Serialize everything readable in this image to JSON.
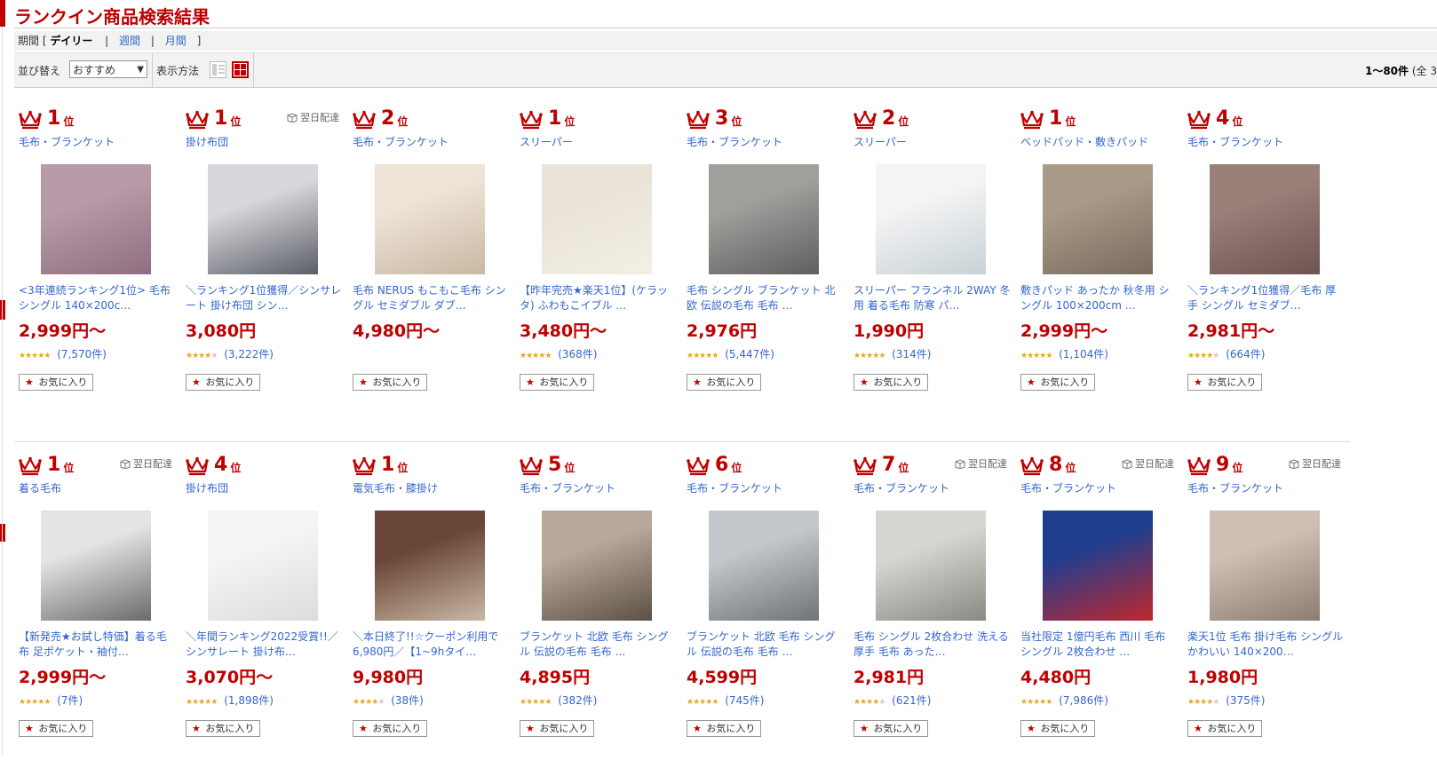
{
  "page": {
    "title": "ランクイン商品検索結果",
    "period": {
      "label": "期間 [",
      "active": "デイリー",
      "weekly": "週間",
      "monthly": "月間",
      "close": "]"
    },
    "sort": {
      "label": "並び替え",
      "selected": "おすすめ"
    },
    "display_label": "表示方法",
    "result_count": "1〜80件",
    "result_total_partial": "(全 3"
  },
  "labels": {
    "delivery": "翌日配達",
    "favorite": "お気に入り",
    "rank_suffix": "位"
  },
  "colors": {
    "accent": "#bf0000",
    "link": "#3366cc",
    "star": "#e4a92a"
  },
  "products": [
    {
      "rank": "1",
      "category": "毛布・ブランケット",
      "name": "<3年連続ランキング1位> 毛布 シングル 140×200c…",
      "price": "2,999円〜",
      "stars": 4.5,
      "reviews": "(7,570件)",
      "delivery": false,
      "img": [
        "#b89aa8",
        "#8f6f80"
      ]
    },
    {
      "rank": "1",
      "category": "掛け布団",
      "name": "＼ランキング1位獲得／シンサレート 掛け布団 シン…",
      "price": "3,080円",
      "stars": 4,
      "reviews": "(3,222件)",
      "delivery": true,
      "img": [
        "#d8d8dc",
        "#5a5f66"
      ]
    },
    {
      "rank": "2",
      "category": "毛布・ブランケット",
      "name": "毛布 NERUS もこもこ毛布 シングル セミダブル ダブ…",
      "price": "4,980円〜",
      "stars": null,
      "reviews": "",
      "delivery": false,
      "img": [
        "#ede3d6",
        "#c9b8a3"
      ]
    },
    {
      "rank": "1",
      "category": "スリーパー",
      "name": "【昨年完売★楽天1位】(ケラッタ) ふわもこイブル …",
      "price": "3,480円〜",
      "stars": 4.5,
      "reviews": "(368件)",
      "delivery": false,
      "img": [
        "#eae4d8",
        "#f3efe5"
      ]
    },
    {
      "rank": "3",
      "category": "毛布・ブランケット",
      "name": "毛布 シングル ブランケット 北欧 伝説の毛布 毛布 …",
      "price": "2,976円",
      "stars": 4.5,
      "reviews": "(5,447件)",
      "delivery": false,
      "img": [
        "#9ea09c",
        "#5e605d"
      ]
    },
    {
      "rank": "2",
      "category": "スリーパー",
      "name": "スリーパー フランネル 2WAY 冬用 着る毛布 防寒 パ…",
      "price": "1,990円",
      "stars": 4.5,
      "reviews": "(314件)",
      "delivery": false,
      "img": [
        "#f4f4f4",
        "#c8d2d6"
      ]
    },
    {
      "rank": "1",
      "category": "ベッドパッド・敷きパッド",
      "name": "敷きパッド あったか 秋冬用 シングル 100×200cm …",
      "price": "2,999円〜",
      "stars": 4.5,
      "reviews": "(1,104件)",
      "delivery": false,
      "img": [
        "#a89a88",
        "#7a6c5c"
      ]
    },
    {
      "rank": "4",
      "category": "毛布・ブランケット",
      "name": "＼ランキング1位獲得／毛布 厚手 シングル セミダブ…",
      "price": "2,981円〜",
      "stars": 4,
      "reviews": "(664件)",
      "delivery": false,
      "img": [
        "#9b7f79",
        "#6d5551"
      ]
    },
    {
      "rank": "1",
      "category": "着る毛布",
      "name": "【新発売★お試し特価】着る毛布 足ポケット・袖付…",
      "price": "2,999円〜",
      "stars": 5,
      "reviews": "(7件)",
      "delivery": true,
      "img": [
        "#e4e4e4",
        "#6a6a6a"
      ]
    },
    {
      "rank": "4",
      "category": "掛け布団",
      "name": "＼年間ランキング2022受賞!!／シンサレート 掛け布…",
      "price": "3,070円〜",
      "stars": 4.5,
      "reviews": "(1,898件)",
      "delivery": false,
      "img": [
        "#f5f5f5",
        "#dcdcdc"
      ]
    },
    {
      "rank": "1",
      "category": "電気毛布・膝掛け",
      "name": "＼本日終了!!☆クーポン利用で6,980円／【1~9hタイ…",
      "price": "9,980円",
      "stars": 4,
      "reviews": "(38件)",
      "delivery": false,
      "img": [
        "#6a4636",
        "#c9b8a6"
      ]
    },
    {
      "rank": "5",
      "category": "毛布・ブランケット",
      "name": "ブランケット 北欧 毛布 シングル 伝説の毛布 毛布 …",
      "price": "4,895円",
      "stars": 4.5,
      "reviews": "(382件)",
      "delivery": false,
      "img": [
        "#b7a89a",
        "#5c5045"
      ]
    },
    {
      "rank": "6",
      "category": "毛布・ブランケット",
      "name": "ブランケット 北欧 毛布 シングル 伝説の毛布 毛布 …",
      "price": "4,599円",
      "stars": 4.5,
      "reviews": "(745件)",
      "delivery": false,
      "img": [
        "#c4c7cb",
        "#6f7479"
      ]
    },
    {
      "rank": "7",
      "category": "毛布・ブランケット",
      "name": "毛布 シングル 2枚合わせ 洗える 厚手 毛布 あった…",
      "price": "2,981円",
      "stars": 4,
      "reviews": "(621件)",
      "delivery": true,
      "img": [
        "#d8d6d2",
        "#8b8983"
      ]
    },
    {
      "rank": "8",
      "category": "毛布・ブランケット",
      "name": "当社限定 1億円毛布 西川 毛布 シングル 2枚合わせ …",
      "price": "4,480円",
      "stars": 4.5,
      "reviews": "(7,986件)",
      "delivery": true,
      "img": [
        "#1f3e8f",
        "#c0272d"
      ]
    },
    {
      "rank": "9",
      "category": "毛布・ブランケット",
      "name": "楽天1位 毛布 掛け毛布 シングル かわいい 140×200…",
      "price": "1,980円",
      "stars": 4,
      "reviews": "(375件)",
      "delivery": true,
      "img": [
        "#cdbfb2",
        "#8c7d70"
      ]
    }
  ]
}
